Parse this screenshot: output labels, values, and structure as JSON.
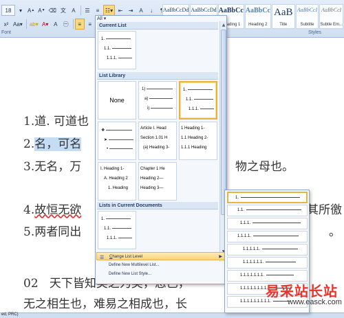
{
  "ribbon": {
    "row1": [
      "18",
      "A",
      "A",
      "Aa",
      "",
      "",
      "",
      "",
      "",
      "",
      "",
      "",
      "",
      ""
    ],
    "font_size": "18",
    "labels": {
      "font": "Font",
      "styles": "Styles"
    },
    "styles": [
      {
        "sample": "AaBbCcDd",
        "name": ""
      },
      {
        "sample": "AaBbCcDd",
        "name": ""
      },
      {
        "sample": "AaBbCc",
        "name": "Heading 1"
      },
      {
        "sample": "AaBbCc",
        "name": "Heading 2"
      },
      {
        "sample": "AaB",
        "name": "Title"
      },
      {
        "sample": "AaBbCcI",
        "name": "Subtitle"
      },
      {
        "sample": "AaBbCcI",
        "name": "Subtle Em..."
      }
    ]
  },
  "document": {
    "lines": [
      {
        "number": "1.",
        "text": "道. 可道也",
        "tail": ""
      },
      {
        "number": "2.",
        "text": "名，可名",
        "tail": ""
      },
      {
        "number": "3.",
        "text": "无名，万",
        "tail": "物之母也。"
      },
      {
        "number": "4.",
        "text": "故恒无欲",
        "tail": "其所徼"
      },
      {
        "number": "5.",
        "text": "两者同出",
        "tail": "。"
      },
      {
        "number": "02",
        "text": "天下皆知美之为美，恶已，",
        "tail": ""
      },
      {
        "number": "",
        "text": "无之相生也，难易之相成也，长",
        "tail": ""
      }
    ]
  },
  "status": {
    "text": "ed, PRC)"
  },
  "multilevel_menu": {
    "all_label": "All ▾",
    "sections": {
      "current": "Current List",
      "library": "List Library",
      "in_documents": "Lists in Current Documents"
    },
    "current_list": [
      "1.",
      "1.1.",
      "1.1.1."
    ],
    "library": [
      {
        "id": "none",
        "label": "None"
      },
      {
        "id": "paren",
        "lines": [
          "1)",
          "a)",
          "i)"
        ]
      },
      {
        "id": "decimal",
        "lines": [
          "1.",
          "1.1.",
          "1.1.1."
        ],
        "selected": true
      },
      {
        "id": "bullets",
        "lines": [
          "❖",
          "➤",
          "•"
        ]
      },
      {
        "id": "article",
        "lines": [
          "Article I. Head",
          "Section 1.01 H",
          "(a) Heading 3-"
        ]
      },
      {
        "id": "heading-num",
        "lines": [
          "1 Heading 1-",
          "1.1 Heading 2-",
          "1.1.1 Heading"
        ]
      },
      {
        "id": "heading-roman",
        "lines": [
          "I. Heading 1-",
          "A. Heading 2",
          "1. Heading"
        ]
      },
      {
        "id": "chapter",
        "lines": [
          "Chapter 1 He",
          "Heading 2—",
          "Heading 3—"
        ]
      }
    ],
    "in_documents": [
      "1.",
      "1.1.",
      "1.1.1."
    ],
    "items": [
      {
        "label": "Change List Level",
        "underline": "C",
        "rest": "hange List Level"
      },
      {
        "label": "Define New Multilevel List...",
        "underline": "",
        "rest": "Define New Multilevel List..."
      },
      {
        "label": "Define New List Style...",
        "underline": "",
        "rest": "Define New List Style..."
      }
    ]
  },
  "level_submenu": {
    "levels": [
      "1.",
      "1.1.",
      "1.1.1.",
      "1.1.1.1.",
      "1.1.1.1.1.",
      "1.1.1.1.1.1.",
      "1.1.1.1.1.1.1.",
      "1.1.1.1.1.1.1.1.",
      "1.1.1.1.1.1.1.1.1."
    ]
  },
  "watermark": {
    "main": "易采站长站",
    "url": "www.easck.com"
  }
}
